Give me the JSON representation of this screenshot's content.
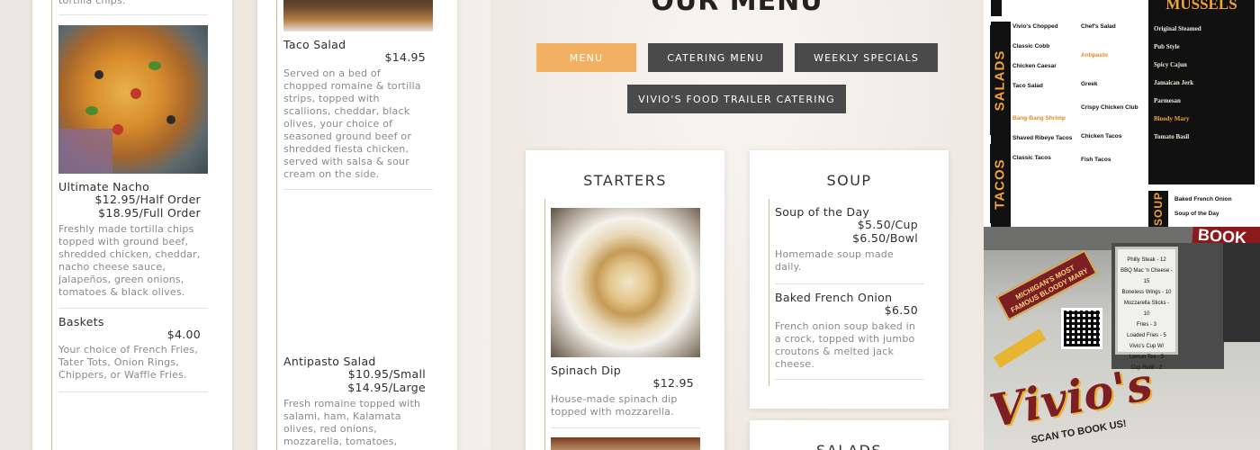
{
  "left_column": {
    "top_fragment": "tortilla chips.",
    "items": [
      {
        "name": "Ultimate Nacho",
        "price_lines": [
          "$12.95/Half Order",
          "$18.95/Full Order"
        ],
        "description": "Freshly made tortilla chips topped with ground beef, shredded chicken, cheddar, nacho cheese sauce, jalapeños, green onions, tomatoes & black olives."
      },
      {
        "name": "Baskets",
        "price_lines": [
          "$4.00"
        ],
        "description": "Your choice of French Fries, Tater Tots, Onion Rings, Chippers, or Waffle Fries."
      }
    ]
  },
  "middle_column": {
    "items": [
      {
        "name": "Taco Salad",
        "price_lines": [
          "$14.95"
        ],
        "description": "Served on a bed of chopped romaine & tortilla strips, topped with scallions, cheddar, black olives, your choice of seasoned ground beef or shredded fiesta chicken, served with salsa & sour cream on the side."
      },
      {
        "name": "Antipasto Salad",
        "price_lines": [
          "$10.95/Small",
          "$14.95/Large"
        ],
        "description": "Fresh romaine topped with salami, ham, Kalamata olives, red onions, mozzarella, tomatoes,"
      }
    ]
  },
  "center": {
    "heading": "OUR MENU",
    "nav": [
      {
        "label": "MENU",
        "active": true
      },
      {
        "label": "CATERING MENU",
        "active": false
      },
      {
        "label": "WEEKLY SPECIALS",
        "active": false
      },
      {
        "label": "VIVIO'S FOOD TRAILER CATERING",
        "active": false
      }
    ],
    "starters": {
      "title": "STARTERS",
      "items": [
        {
          "name": "Spinach Dip",
          "price_lines": [
            "$12.95"
          ],
          "description": "House-made spinach dip topped with mozzarella."
        }
      ]
    },
    "soup": {
      "title": "SOUP",
      "items": [
        {
          "name": "Soup of the Day",
          "price_lines": [
            "$5.50/Cup",
            "$6.50/Bowl"
          ],
          "description": "Homemade soup made daily."
        },
        {
          "name": "Baked French Onion",
          "price_lines": [
            "$6.50"
          ],
          "description": "French onion soup baked in a crock, topped with jumbo croutons & melted jack cheese."
        }
      ]
    },
    "salads": {
      "title": "SALADS"
    }
  },
  "board_photo": {
    "side_labels": [
      "SALADS",
      "TACOS",
      "SOUP"
    ],
    "col1": [
      {
        "name": "Vivio's Chopped",
        "accent": false
      },
      {
        "name": "Classic Cobb",
        "accent": false
      },
      {
        "name": "Chicken Caesar",
        "accent": false
      },
      {
        "name": "Taco Salad",
        "accent": false
      },
      {
        "name": "Bang-Bang Shrimp",
        "accent": true
      },
      {
        "name": "Shaved Ribeye Tacos",
        "accent": false
      },
      {
        "name": "Classic Tacos",
        "accent": false
      }
    ],
    "col2": [
      {
        "name": "Chef's Salad",
        "accent": false
      },
      {
        "name": "Antipasto",
        "accent": true
      },
      {
        "name": "Greek",
        "accent": false
      },
      {
        "name": "Crispy Chicken Club",
        "accent": false
      },
      {
        "name": "Chicken Tacos",
        "accent": false
      },
      {
        "name": "Fish Tacos",
        "accent": false
      }
    ],
    "mussels_title": "MUSSELS",
    "mussels": [
      {
        "name": "Original Steamed",
        "accent": false
      },
      {
        "name": "Pub Style",
        "accent": false
      },
      {
        "name": "Spicy Cajun",
        "accent": false
      },
      {
        "name": "Jamaican Jerk",
        "accent": false
      },
      {
        "name": "Parmesan",
        "accent": false
      },
      {
        "name": "Bloody Mary",
        "accent": true
      },
      {
        "name": "Tomato Basil",
        "accent": false
      }
    ],
    "soup_items": [
      "Baked French Onion",
      "Soup of the Day"
    ]
  },
  "truck_photo": {
    "book_sign": "BOOK US",
    "banner": "MICHIGAN'S MOST FAMOUS BLOODY MARY",
    "menu_lines": [
      "Philly Steak - 12",
      "BBQ Mac 'n Cheese - 15",
      "Boneless Wings - 10",
      "Mozzarella Sticks - 10",
      "Fries - 3",
      "Loaded Fries - 5",
      "Vivio's Cup W/ Lemon Tea - 5",
      "Cup Refill - 2"
    ],
    "logo": "Vivio's",
    "scan_text": "SCAN TO BOOK US!"
  },
  "colors": {
    "accent": "#f2b162",
    "nav_dark": "#4a4a4a",
    "divider_gold": "#cdbf8a"
  }
}
